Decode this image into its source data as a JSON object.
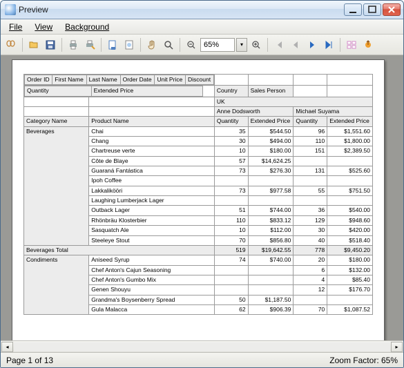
{
  "window": {
    "title": "Preview"
  },
  "menu": {
    "file": "File",
    "view": "View",
    "background": "Background"
  },
  "toolbar": {
    "zoom_value": "65%"
  },
  "status": {
    "page_label": "Page 1 of 13",
    "zoom_label": "Zoom Factor: 65%"
  },
  "report": {
    "column_fields": [
      "Order ID",
      "First Name",
      "Last Name",
      "Order Date",
      "Unit Price",
      "Discount"
    ],
    "row_fields": [
      "Quantity",
      "Extended Price"
    ],
    "col_group_fields": [
      "Country",
      "Sales Person"
    ],
    "country": "UK",
    "salespersons": [
      "Anne Dodsworth",
      "Michael Suyama"
    ],
    "row_header_labels": [
      "Category Name",
      "Product Name"
    ],
    "measure_labels": [
      "Quantity",
      "Extended Price"
    ],
    "groups": [
      {
        "category": "Beverages",
        "rows": [
          {
            "product": "Chai",
            "v": [
              "35",
              "$544.50",
              "96",
              "$1,551.60"
            ]
          },
          {
            "product": "Chang",
            "v": [
              "30",
              "$494.00",
              "110",
              "$1,800.00"
            ]
          },
          {
            "product": "Chartreuse verte",
            "v": [
              "10",
              "$180.00",
              "151",
              "$2,389.50"
            ]
          },
          {
            "product": "Côte de Blaye",
            "v": [
              "57",
              "$14,624.25",
              "",
              ""
            ]
          },
          {
            "product": "Guaraná Fantástica",
            "v": [
              "73",
              "$276.30",
              "131",
              "$525.60"
            ]
          },
          {
            "product": "Ipoh Coffee",
            "v": [
              "",
              "",
              "",
              ""
            ]
          },
          {
            "product": "Lakkalikööri",
            "v": [
              "73",
              "$977.58",
              "55",
              "$751.50"
            ]
          },
          {
            "product": "Laughing Lumberjack Lager",
            "v": [
              "",
              "",
              "",
              ""
            ]
          },
          {
            "product": "Outback Lager",
            "v": [
              "51",
              "$744.00",
              "36",
              "$540.00"
            ]
          },
          {
            "product": "Rhönbräu Klosterbier",
            "v": [
              "110",
              "$833.12",
              "129",
              "$948.60"
            ]
          },
          {
            "product": "Sasquatch Ale",
            "v": [
              "10",
              "$112.00",
              "30",
              "$420.00"
            ]
          },
          {
            "product": "Steeleye Stout",
            "v": [
              "70",
              "$856.80",
              "40",
              "$518.40"
            ]
          }
        ],
        "total_label": "Beverages Total",
        "total": [
          "519",
          "$19,642.55",
          "778",
          "$9,450.20"
        ]
      },
      {
        "category": "Condiments",
        "rows": [
          {
            "product": "Aniseed Syrup",
            "v": [
              "74",
              "$740.00",
              "20",
              "$180.00"
            ]
          },
          {
            "product": "Chef Anton's Cajun Seasoning",
            "v": [
              "",
              "",
              "6",
              "$132.00"
            ]
          },
          {
            "product": "Chef Anton's Gumbo Mix",
            "v": [
              "",
              "",
              "4",
              "$85.40"
            ]
          },
          {
            "product": "Genen Shouyu",
            "v": [
              "",
              "",
              "12",
              "$176.70"
            ]
          },
          {
            "product": "Grandma's Boysenberry Spread",
            "v": [
              "50",
              "$1,187.50",
              "",
              ""
            ]
          },
          {
            "product": "Gula Malacca",
            "v": [
              "62",
              "$906.39",
              "70",
              "$1,087.52"
            ]
          }
        ]
      }
    ]
  }
}
